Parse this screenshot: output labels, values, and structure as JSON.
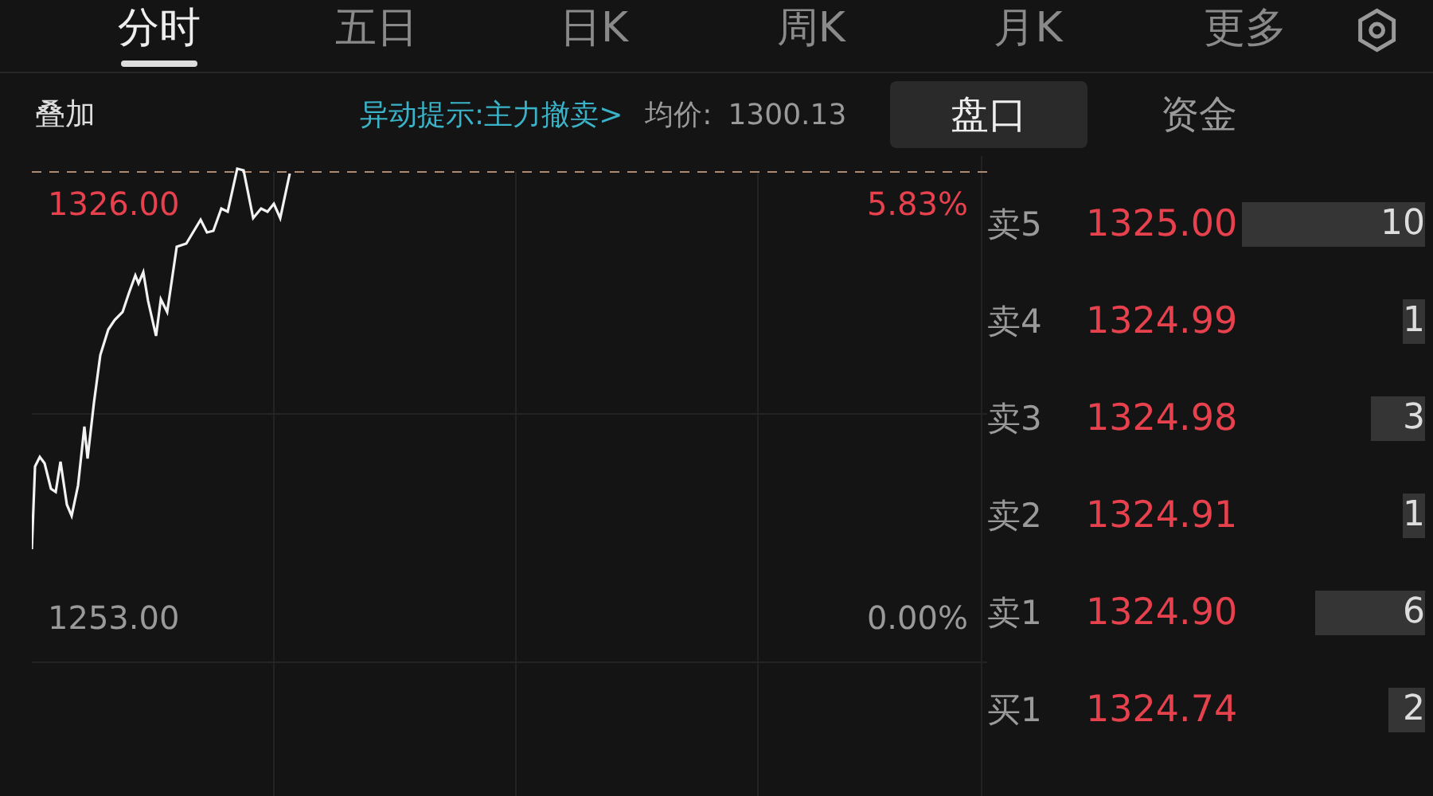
{
  "tabs": [
    {
      "label": "分时",
      "selected": true
    },
    {
      "label": "五日",
      "selected": false
    },
    {
      "label": "日K",
      "selected": false
    },
    {
      "label": "周K",
      "selected": false
    },
    {
      "label": "月K",
      "selected": false
    },
    {
      "label": "更多",
      "selected": false
    }
  ],
  "toolbar": {
    "overlay": "叠加",
    "alert": "异动提示:主力撤卖>",
    "avg_label": "均价:",
    "avg_value": "1300.13"
  },
  "panel_tabs": [
    {
      "label": "盘口",
      "selected": true
    },
    {
      "label": "资金",
      "selected": false
    }
  ],
  "chart": {
    "high_price": "1326.00",
    "high_pct": "5.83%",
    "base_price": "1253.00",
    "base_pct": "0.00%"
  },
  "order_book": [
    {
      "label": "卖5",
      "price": "1325.00",
      "volume": "10"
    },
    {
      "label": "卖4",
      "price": "1324.99",
      "volume": "1"
    },
    {
      "label": "卖3",
      "price": "1324.98",
      "volume": "3"
    },
    {
      "label": "卖2",
      "price": "1324.91",
      "volume": "1"
    },
    {
      "label": "卖1",
      "price": "1324.90",
      "volume": "6"
    },
    {
      "label": "买1",
      "price": "1324.74",
      "volume": "2"
    }
  ]
}
